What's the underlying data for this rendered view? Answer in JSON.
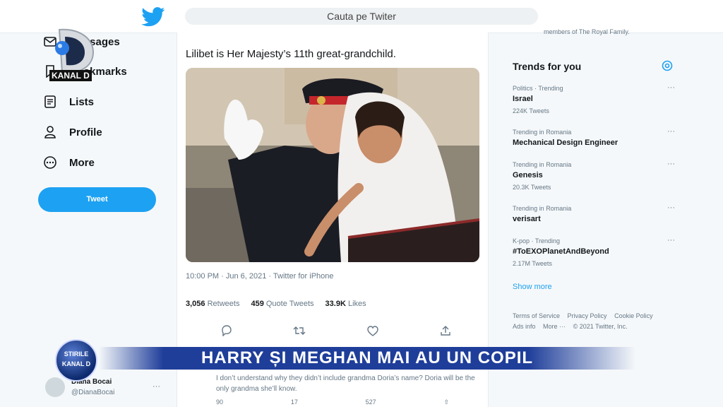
{
  "header": {
    "search_placeholder": "Cauta pe Twiter"
  },
  "sidebar": {
    "items": [
      {
        "label": "Messages",
        "icon": "envelope-icon"
      },
      {
        "label": "Bookmarks",
        "icon": "bookmark-icon"
      },
      {
        "label": "Lists",
        "icon": "list-icon"
      },
      {
        "label": "Profile",
        "icon": "person-icon"
      },
      {
        "label": "More",
        "icon": "more-circle-icon"
      }
    ],
    "tweet_button": "Tweet"
  },
  "channel_logo": {
    "text": "KANAL D"
  },
  "tweet": {
    "text": "Lilibet is Her Majesty’s 11th great-grandchild.",
    "meta": "10:00 PM · Jun 6, 2021 · Twitter for iPhone",
    "retweets": "3,056",
    "retweets_label": "Retweets",
    "quotes": "459",
    "quotes_label": "Quote Tweets",
    "likes": "33.9K",
    "likes_label": "Likes"
  },
  "reply": {
    "name": "Diana Bocai",
    "handle": "@DianaBocai",
    "text": "I don’t understand why they didn’t include grandma Doria’s name? Doria will be the only grandma she’ll know.",
    "reply_count": "90",
    "retweet_count": "17",
    "like_count": "527"
  },
  "right_top_text": "members of The Royal Family.",
  "trends": {
    "title": "Trends for you",
    "items": [
      {
        "context": "Politics · Trending",
        "name": "Israel",
        "count": "224K Tweets"
      },
      {
        "context": "Trending in Romania",
        "name": "Mechanical Design Engineer",
        "count": ""
      },
      {
        "context": "Trending in Romania",
        "name": "Genesis",
        "count": "20.3K Tweets"
      },
      {
        "context": "Trending in Romania",
        "name": "verisart",
        "count": ""
      },
      {
        "context": "K-pop · Trending",
        "name": "#ToEXOPlanetAndBeyond",
        "count": "2.17M Tweets"
      }
    ],
    "show_more": "Show more"
  },
  "footer": {
    "terms": "Terms of Service",
    "privacy": "Privacy Policy",
    "cookie": "Cookie Policy",
    "ads": "Ads info",
    "more": "More ···",
    "copyright": "© 2021 Twitter, Inc."
  },
  "banner": {
    "headline": "HARRY ȘI MEGHAN MAI AU UN COPIL",
    "logo_top": "STIRILE",
    "logo_bottom": "KANAL D"
  },
  "colors": {
    "accent": "#1da1f2",
    "banner": "#1f3e9a"
  }
}
